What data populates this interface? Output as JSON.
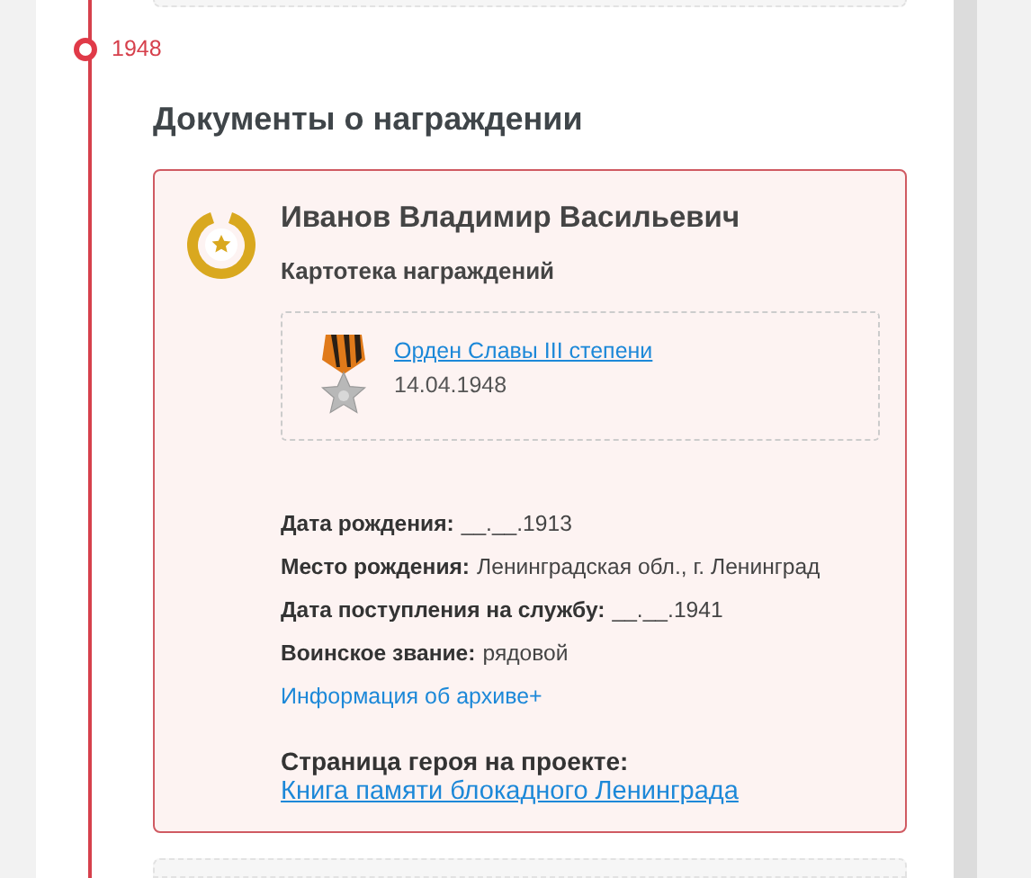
{
  "timeline": {
    "year": "1948"
  },
  "section": {
    "title": "Документы о награждении"
  },
  "record": {
    "name": "Иванов Владимир Васильевич",
    "source": "Картотека награждений",
    "award": {
      "title": "Орден Славы III степени",
      "date": "14.04.1948"
    },
    "fields": [
      {
        "label": "Дата рождения:",
        "value": "__.__.1913"
      },
      {
        "label": "Место рождения:",
        "value": "Ленинградская обл., г. Ленинград"
      },
      {
        "label": "Дата поступления на службу:",
        "value": "__.__.1941"
      },
      {
        "label": "Воинское звание:",
        "value": "рядовой"
      }
    ],
    "archive_link": "Информация об архиве+",
    "hero_page": {
      "label": "Страница героя на проекте:",
      "link": "Книга памяти блокадного Ленинграда"
    }
  }
}
